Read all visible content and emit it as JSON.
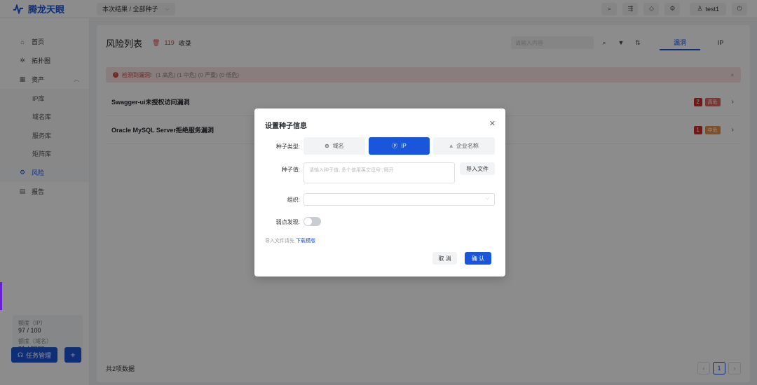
{
  "app": {
    "logo_text": "腾龙天眼"
  },
  "topbar": {
    "scope": "本次结果 / 全部种子",
    "icons": [
      "search-icon",
      "share-icon",
      "tag-icon",
      "settings-icon"
    ],
    "user": "test1"
  },
  "sidebar": {
    "items": [
      {
        "label": "首页",
        "icon": "home-icon"
      },
      {
        "label": "拓扑图",
        "icon": "topology-icon"
      },
      {
        "label": "资产",
        "icon": "assets-icon"
      }
    ],
    "sub_items": [
      "IP库",
      "域名库",
      "服务库",
      "矩阵库"
    ],
    "bottom_items": [
      {
        "label": "风险",
        "icon": "risk-icon",
        "active": true
      },
      {
        "label": "报告",
        "icon": "report-icon"
      }
    ],
    "quota": {
      "ip_label": "额度（IP）",
      "ip_value": "97 / 100",
      "domain_label": "额度（域名）",
      "domain_value": "91 / 2000"
    },
    "task_button": "任务管理",
    "plus_button": "+"
  },
  "main": {
    "title": "风险列表",
    "count": "119",
    "collapse_label": "收录",
    "search_placeholder": "请输入内容",
    "tabs": [
      "漏洞",
      "IP"
    ],
    "alert": {
      "text": "检测到漏洞!",
      "detail": "(1 高危) (1 中危) (0 严重) (0 低危)"
    },
    "rows": [
      {
        "name": "Swagger-ui未授权访问漏洞",
        "count": "2",
        "severity": "高危",
        "sev_color": "#e36363"
      },
      {
        "name": "Oracle MySQL Server拒绝服务漏洞",
        "count": "1",
        "severity": "中危",
        "sev_color": "#e8914a"
      }
    ],
    "footer": "共2项数据",
    "page": "1"
  },
  "dialog": {
    "title": "设置种子信息",
    "seed_type_label": "种子类型:",
    "seed_types": [
      "域名",
      "IP",
      "企业名称"
    ],
    "seed_value_label": "种子值:",
    "seed_placeholder": "请输入种子值, 多个值用英文逗号','隔开",
    "import_button": "导入文件",
    "org_label": "组织:",
    "weak_label": "弱点发现:",
    "hint_text": "导入文件请先",
    "hint_link": "下载模版",
    "cancel": "取 消",
    "confirm": "确 认"
  }
}
